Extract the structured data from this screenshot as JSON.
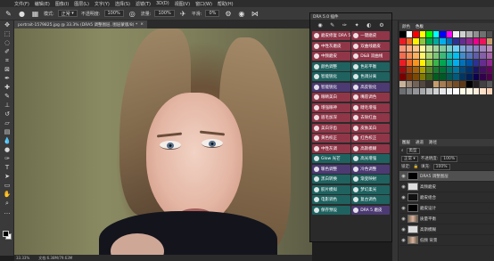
{
  "menubar": {
    "items": [
      "文件(F)",
      "编辑(E)",
      "图像(I)",
      "图层(L)",
      "文字(Y)",
      "选择(S)",
      "滤镜(T)",
      "3D(D)",
      "视图(V)",
      "窗口(W)",
      "帮助(H)"
    ]
  },
  "options": {
    "mode_label": "模式:",
    "mode_value": "正常",
    "opacity_label": "不透明度:",
    "opacity_value": "100%",
    "flow_label": "流量:",
    "flow_value": "100%",
    "smooth_label": "平滑:",
    "smooth_value": "0%"
  },
  "document": {
    "tab_label": "portrait-1579825.jpg @ 33.3% (DRA5 调整图层, 图层蒙版/8) *",
    "zoom": "33.33%",
    "doc_size": "文档:6.38M/79.63M"
  },
  "plugin": {
    "title": "DRA 5.0 插件",
    "buttons": [
      {
        "label": "磨皮修复 DRA 5.0",
        "color": "red"
      },
      {
        "label": "一键磨皮",
        "color": "red"
      },
      {
        "label": "中性灰磨皮",
        "color": "red"
      },
      {
        "label": "双曲线磨皮",
        "color": "red"
      },
      {
        "label": "中频磨皮",
        "color": "red"
      },
      {
        "label": "D&B 双曲线",
        "color": "red"
      },
      {
        "label": "颜色调整",
        "color": "teal"
      },
      {
        "label": "色彩平衡",
        "color": "teal"
      },
      {
        "label": "智能锐化",
        "color": "teal"
      },
      {
        "label": "色调分离",
        "color": "teal"
      },
      {
        "label": "智能锐化",
        "color": "purple"
      },
      {
        "label": "高反锐化",
        "color": "purple"
      },
      {
        "label": "眼睛美白",
        "color": "red"
      },
      {
        "label": "嘴唇调色",
        "color": "red"
      },
      {
        "label": "增强眼神",
        "color": "red"
      },
      {
        "label": "睫毛增强",
        "color": "red"
      },
      {
        "label": "眉毛加深",
        "color": "red"
      },
      {
        "label": "去除红血",
        "color": "red"
      },
      {
        "label": "美白牙齿",
        "color": "red"
      },
      {
        "label": "皮肤美白",
        "color": "red"
      },
      {
        "label": "黄色校正",
        "color": "red"
      },
      {
        "label": "红色校正",
        "color": "red"
      },
      {
        "label": "中性灰调",
        "color": "red"
      },
      {
        "label": "高斯模糊",
        "color": "red"
      },
      {
        "label": "Glow 光芒",
        "color": "teal"
      },
      {
        "label": "高光增强",
        "color": "teal"
      },
      {
        "label": "暖色调整",
        "color": "purple"
      },
      {
        "label": "冷色调整",
        "color": "purple"
      },
      {
        "label": "黑白转换",
        "color": "teal"
      },
      {
        "label": "渐变映射",
        "color": "teal"
      },
      {
        "label": "胶片模拟",
        "color": "teal"
      },
      {
        "label": "梦幻柔光",
        "color": "teal"
      },
      {
        "label": "电影调色",
        "color": "teal"
      },
      {
        "label": "复古调色",
        "color": "teal"
      },
      {
        "label": "保存预设",
        "color": "teal"
      },
      {
        "label": "DRA 5 磨皮",
        "color": "purple"
      }
    ]
  },
  "swatches_panel": {
    "tabs": [
      "颜色",
      "色板"
    ],
    "colors": [
      "#000000",
      "#ffffff",
      "#ff0000",
      "#ffff00",
      "#00ff00",
      "#00ffff",
      "#0000ff",
      "#ff00ff",
      "#f0f0f0",
      "#d0d0d0",
      "#b0b0b0",
      "#909090",
      "#707070",
      "#505050",
      "#ed1c24",
      "#f26522",
      "#fff200",
      "#8dc63f",
      "#00a651",
      "#00a99d",
      "#00aeef",
      "#0072bc",
      "#2e3192",
      "#662d91",
      "#92278f",
      "#ec008c",
      "#ed145b",
      "#c69c6d",
      "#f7977a",
      "#f9ad81",
      "#fdc68a",
      "#fff79a",
      "#c4df9b",
      "#a3d39c",
      "#82ca9d",
      "#7bcdc8",
      "#6ecff6",
      "#7ea7d8",
      "#8493ca",
      "#8882be",
      "#a187be",
      "#bc8dbf",
      "#f26c4f",
      "#f68e55",
      "#fbaf5c",
      "#fff467",
      "#acd372",
      "#7cc576",
      "#3bb878",
      "#1abbb4",
      "#00bff3",
      "#438ccb",
      "#5574b9",
      "#605ca8",
      "#855fa8",
      "#a763a8",
      "#ed1c24",
      "#f26522",
      "#f7941d",
      "#fff200",
      "#8dc63f",
      "#39b54a",
      "#00a651",
      "#00a99d",
      "#00aeef",
      "#0072bc",
      "#0054a6",
      "#2e3192",
      "#662d91",
      "#92278f",
      "#9e0b0f",
      "#a0410d",
      "#a3620a",
      "#aba000",
      "#598527",
      "#197b30",
      "#007236",
      "#00746b",
      "#0076a3",
      "#004a80",
      "#003471",
      "#1b1464",
      "#440e62",
      "#630460",
      "#790000",
      "#7b2e00",
      "#7d4900",
      "#827b00",
      "#406618",
      "#005e20",
      "#005826",
      "#005952",
      "#005b7f",
      "#003663",
      "#002157",
      "#0d004c",
      "#32004b",
      "#4b0049",
      "#c7b299",
      "#998675",
      "#736357",
      "#534741",
      "#37302d",
      "#c69c6d",
      "#a67c52",
      "#8c6239",
      "#754c24",
      "#603913",
      "#000000",
      "#231f20",
      "#414042",
      "#58595b",
      "#6d6e71",
      "#808285",
      "#939598",
      "#a7a9ac",
      "#bcbec0",
      "#d1d3d4",
      "#e6e7e8",
      "#f1f2f2",
      "#ffffff",
      "#fffbe6",
      "#fef6e4",
      "#fdeedb",
      "#fcdfc8",
      "#fad1b6"
    ]
  },
  "layers_panel": {
    "tabs": [
      "图层",
      "通道",
      "路径"
    ],
    "kind_label": "类型",
    "blend_value": "正常",
    "opacity_label": "不透明度:",
    "opacity_value": "100%",
    "lock_label": "锁定:",
    "fill_label": "填充:",
    "fill_value": "100%",
    "layers": [
      {
        "name": "DRA5 调整图层",
        "thumb": "black",
        "selected": true
      },
      {
        "name": "高频磨皮",
        "thumb": "white",
        "selected": false
      },
      {
        "name": "磨皮组合",
        "thumb": "dark",
        "selected": false
      },
      {
        "name": "磨皮设计",
        "thumb": "black",
        "selected": false
      },
      {
        "name": "质量平衡",
        "thumb": "photo",
        "selected": false
      },
      {
        "name": "高斯模糊",
        "thumb": "white",
        "selected": false
      },
      {
        "name": "低频 背景",
        "thumb": "photo",
        "selected": false
      }
    ]
  }
}
